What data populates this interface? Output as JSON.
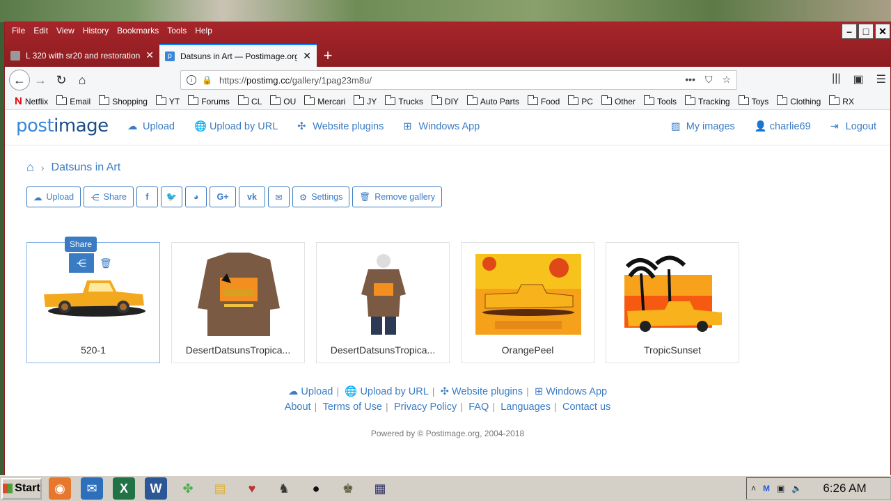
{
  "browser": {
    "menu": [
      "File",
      "Edit",
      "View",
      "History",
      "Bookmarks",
      "Tools",
      "Help"
    ],
    "tabs": [
      {
        "title": "L 320 with sr20 and restoration -"
      },
      {
        "title": "Datsuns in Art — Postimage.org"
      }
    ],
    "url": {
      "prefix": "https://",
      "host": "postimg.cc",
      "path": "/gallery/1pag23m8u/"
    },
    "bookmarks": [
      "Netflix",
      "Email",
      "Shopping",
      "YT",
      "Forums",
      "CL",
      "OU",
      "Mercari",
      "JY",
      "Trucks",
      "DIY",
      "Auto Parts",
      "Food",
      "PC",
      "Other",
      "Tools",
      "Tracking",
      "Toys",
      "Clothing",
      "RX"
    ]
  },
  "site": {
    "logo_a": "post",
    "logo_b": "image",
    "nav": {
      "upload": "Upload",
      "upload_url": "Upload by URL",
      "plugins": "Website plugins",
      "windows": "Windows App"
    },
    "user": {
      "my_images": "My images",
      "username": "charlie69",
      "logout": "Logout"
    }
  },
  "breadcrumb": {
    "current": "Datsuns in Art"
  },
  "toolbar": {
    "upload": "Upload",
    "share": "Share",
    "settings": "Settings",
    "remove": "Remove gallery"
  },
  "gallery": [
    {
      "label": "520-1"
    },
    {
      "label": "DesertDatsunsTropica..."
    },
    {
      "label": "DesertDatsunsTropica..."
    },
    {
      "label": "OrangePeel"
    },
    {
      "label": "TropicSunset"
    }
  ],
  "share_tooltip": "Share",
  "footer": {
    "row1": [
      "Upload",
      "Upload by URL",
      "Website plugins",
      "Windows App"
    ],
    "row2": [
      "About",
      "Terms of Use",
      "Privacy Policy",
      "FAQ",
      "Languages",
      "Contact us"
    ],
    "powered": "Powered by © Postimage.org, 2004-2018"
  },
  "taskbar": {
    "start": "Start",
    "clock": "6:26 AM"
  },
  "colors": {
    "accent": "#3a7cc4",
    "titlebar": "#a7252a",
    "logo_dark": "#1c4e86"
  }
}
